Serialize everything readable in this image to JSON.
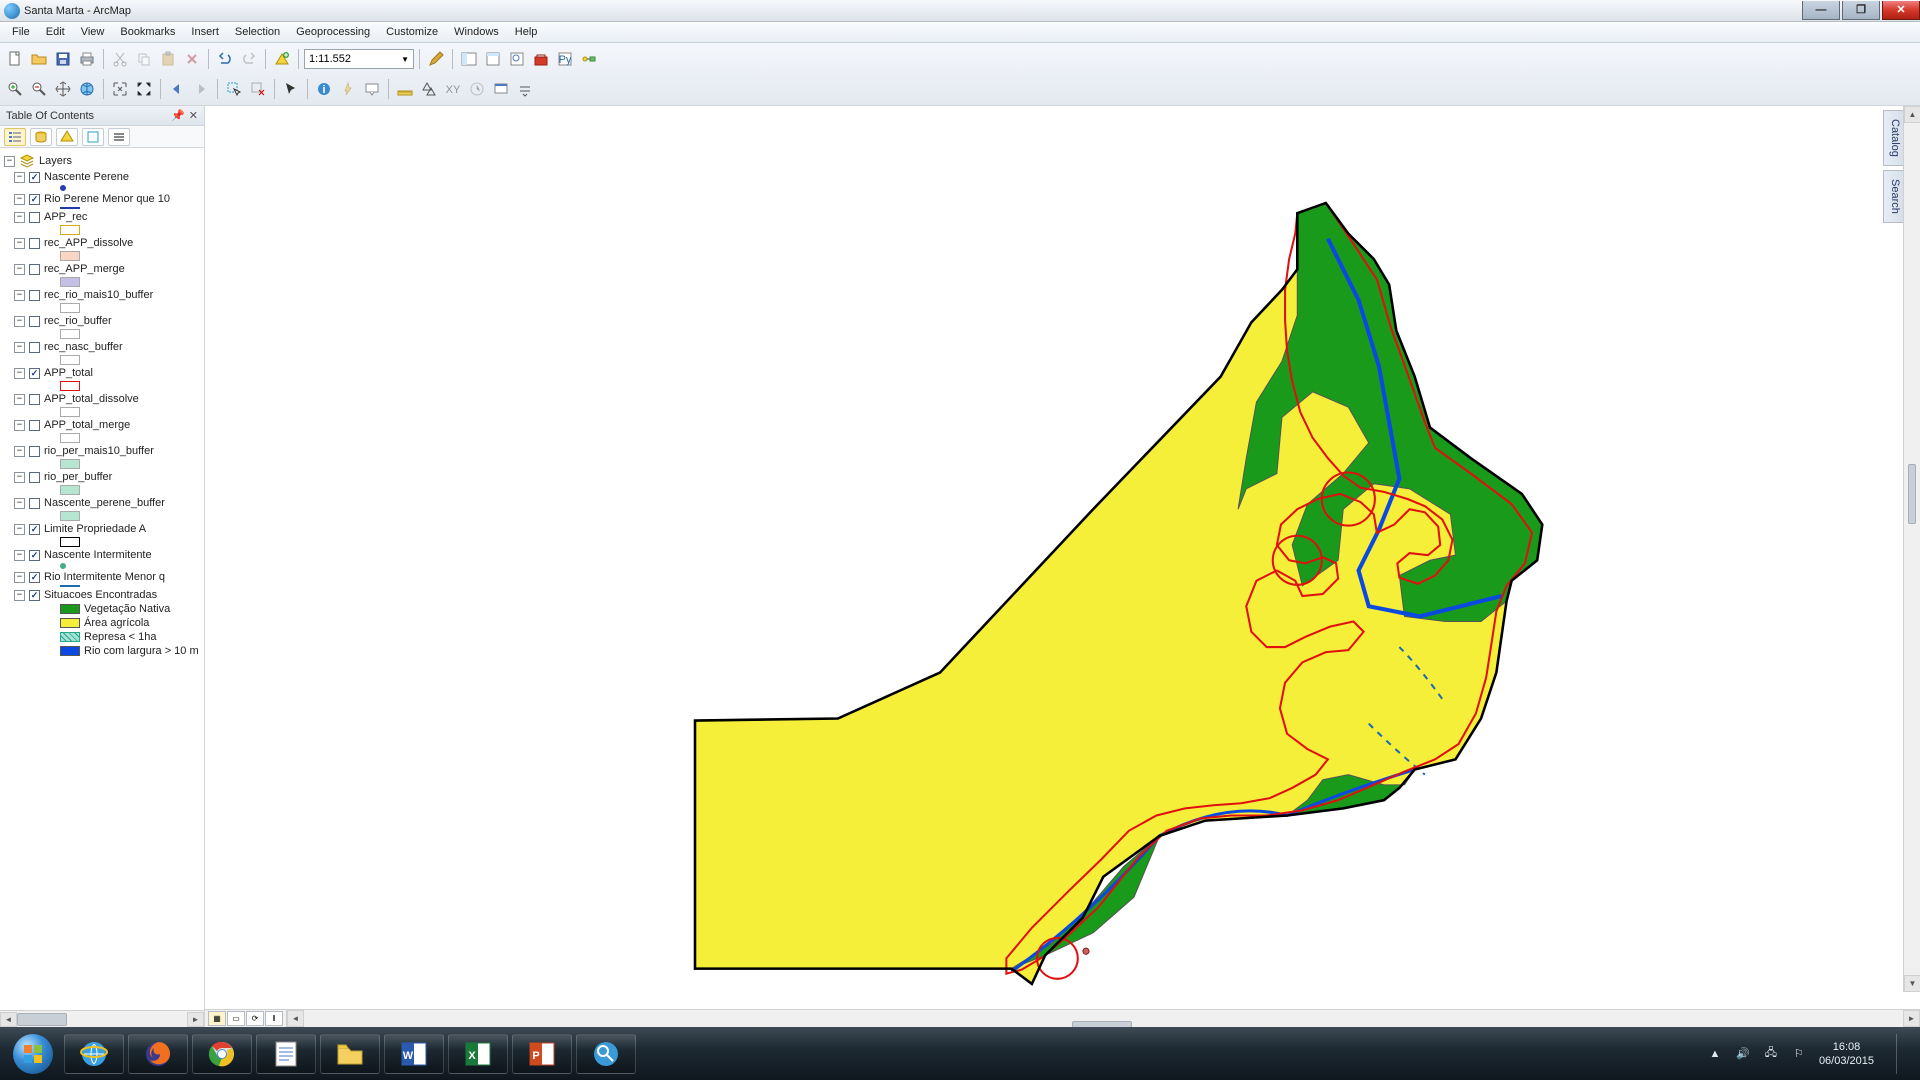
{
  "window": {
    "title": "Santa Marta - ArcMap"
  },
  "menu": [
    "File",
    "Edit",
    "View",
    "Bookmarks",
    "Insert",
    "Selection",
    "Geoprocessing",
    "Customize",
    "Windows",
    "Help"
  ],
  "scale": "1:11.552",
  "toc": {
    "title": "Table Of Contents",
    "root": "Layers",
    "layers": [
      {
        "name": "Nascente Perene",
        "checked": true,
        "sym": {
          "type": "point",
          "fill": "#2a3ab0"
        }
      },
      {
        "name": "Rio Perene Menor que 10",
        "checked": true,
        "sym": {
          "type": "line",
          "stroke": "#1e3aa8"
        }
      },
      {
        "name": "APP_rec",
        "checked": false,
        "sym": {
          "type": "poly",
          "fill": "none",
          "stroke": "#d7a818"
        }
      },
      {
        "name": "rec_APP_dissolve",
        "checked": false,
        "sym": {
          "type": "poly",
          "fill": "#f7d6c4",
          "stroke": "#aaa"
        }
      },
      {
        "name": "rec_APP_merge",
        "checked": false,
        "sym": {
          "type": "poly",
          "fill": "#c3bfe6",
          "stroke": "#aaa"
        }
      },
      {
        "name": "rec_rio_mais10_buffer",
        "checked": false,
        "sym": {
          "type": "poly",
          "fill": "none",
          "stroke": "#aaa"
        }
      },
      {
        "name": "rec_rio_buffer",
        "checked": false,
        "sym": {
          "type": "poly",
          "fill": "none",
          "stroke": "#aaa"
        }
      },
      {
        "name": "rec_nasc_buffer",
        "checked": false,
        "sym": {
          "type": "poly",
          "fill": "none",
          "stroke": "#aaa"
        }
      },
      {
        "name": "APP_total",
        "checked": true,
        "sym": {
          "type": "poly",
          "fill": "none",
          "stroke": "#e01010"
        }
      },
      {
        "name": "APP_total_dissolve",
        "checked": false,
        "sym": {
          "type": "poly",
          "fill": "none",
          "stroke": "#aaa"
        }
      },
      {
        "name": "APP_total_merge",
        "checked": false,
        "sym": {
          "type": "poly",
          "fill": "none",
          "stroke": "#aaa"
        }
      },
      {
        "name": "rio_per_mais10_buffer",
        "checked": false,
        "sym": {
          "type": "poly",
          "fill": "#b6e6d2",
          "stroke": "#aaa"
        }
      },
      {
        "name": "rio_per_buffer",
        "checked": false,
        "sym": {
          "type": "poly",
          "fill": "#b6e6d2",
          "stroke": "#aaa"
        }
      },
      {
        "name": "Nascente_perene_buffer",
        "checked": false,
        "sym": {
          "type": "poly",
          "fill": "#b6e6d2",
          "stroke": "#aaa"
        }
      },
      {
        "name": "Limite Propriedade A",
        "checked": true,
        "sym": {
          "type": "poly",
          "fill": "none",
          "stroke": "#000"
        }
      },
      {
        "name": "Nascente Intermitente",
        "checked": true,
        "sym": {
          "type": "point",
          "fill": "#4a8"
        }
      },
      {
        "name": "Rio Intermitente Menor q",
        "checked": true,
        "sym": {
          "type": "line",
          "stroke": "#1e6ab0"
        }
      },
      {
        "name": "Situacoes Encontradas",
        "checked": true,
        "group": true,
        "classes": [
          {
            "label": "Vegetação Nativa",
            "fill": "#1a9a1a",
            "stroke": "#555"
          },
          {
            "label": "Área agrícola",
            "fill": "#f6ef3a",
            "stroke": "#555"
          },
          {
            "label": "Represa < 1ha",
            "fill": "#a6e2d8",
            "stroke": "#2a8",
            "hatch": true
          },
          {
            "label": "Rio com largura > 10 m",
            "fill": "#0a4ae0",
            "stroke": "#555"
          }
        ]
      }
    ]
  },
  "sidetabs": [
    "Catalog",
    "Search"
  ],
  "tray": {
    "time": "16:08",
    "date": "06/03/2015"
  }
}
